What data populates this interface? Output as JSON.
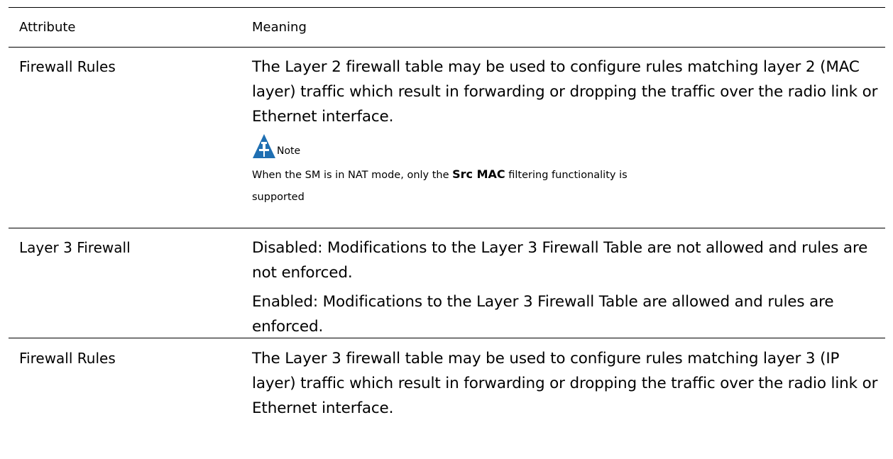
{
  "header": {
    "attribute": "Attribute",
    "meaning": "Meaning"
  },
  "rows": [
    {
      "attribute": "Firewall Rules",
      "meaning": "The Layer 2 firewall table may be used to configure rules matching layer 2 (MAC layer) traffic which result in forwarding or dropping the traffic over the radio link or Ethernet interface.",
      "note": {
        "icon": "note-icon",
        "label": "Note",
        "text_before": "When the SM is in NAT mode, only the ",
        "text_bold": "Src MAC",
        "text_after": " filtering functionality is supported"
      }
    },
    {
      "attribute": "Layer 3 Firewall",
      "paragraphs": [
        "Disabled:  Modifications to the Layer 3 Firewall Table are not allowed and rules are not enforced.",
        "Enabled:  Modifications to the Layer 3 Firewall Table are allowed and rules are enforced."
      ]
    },
    {
      "attribute": "Firewall Rules",
      "meaning": "The Layer 3 firewall table may be used to configure rules matching layer 3 (IP layer) traffic which result in forwarding or dropping the traffic over the radio link or Ethernet interface."
    }
  ],
  "colors": {
    "text": "#000000",
    "icon_blue": "#1f6fb2",
    "icon_white": "#ffffff"
  }
}
